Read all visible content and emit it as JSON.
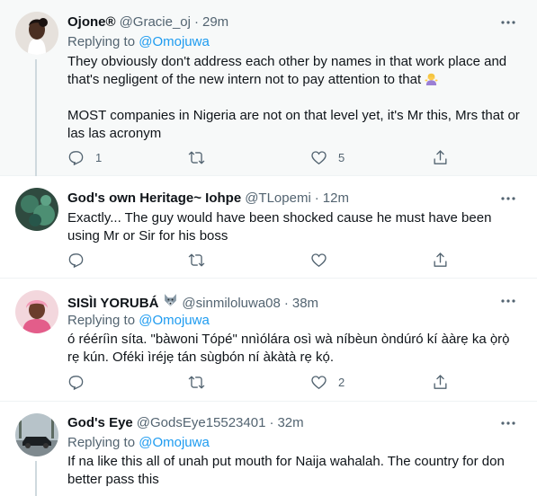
{
  "tweets": [
    {
      "name": "Ojone®",
      "handle": "@Gracie_oj",
      "time": "29m",
      "replying_prefix": "Replying to",
      "replying_to": "@Omojuwa",
      "paragraphs": [
        "They obviously don't address each other by names in that work place and that's negligent of the new intern not to pay attention to that",
        "MOST companies in Nigeria are not on that level yet, it's Mr this, Mrs that or las las acronym"
      ],
      "reply_count": "1",
      "retweet_count": "",
      "like_count": "5"
    },
    {
      "name": "God's own Heritage~ Iohpe",
      "handle": "@TLopemi",
      "time": "12m",
      "paragraphs": [
        "Exactly... The guy would have been shocked cause he must have been using Mr or Sir for his boss"
      ],
      "reply_count": "",
      "retweet_count": "",
      "like_count": ""
    },
    {
      "name": "SISÌI YORUBÁ",
      "handle": "@sinmiloluwa08",
      "time": "38m",
      "replying_prefix": "Replying to",
      "replying_to": "@Omojuwa",
      "paragraphs": [
        "ó rééríìn síta. \"bàwoni Tópé\" nnìólára osì wà níbèun òndúró kí ààrẹ ka ọ̀rọ̀ rẹ kún. Oféki ìréjẹ tán sùgbón ní àkàtà rẹ kọ́."
      ],
      "reply_count": "",
      "retweet_count": "",
      "like_count": "2"
    },
    {
      "name": "God's Eye",
      "handle": "@GodsEye15523401",
      "time": "32m",
      "replying_prefix": "Replying to",
      "replying_to": "@Omojuwa",
      "paragraphs": [
        "If na like this all of unah put mouth for Naija wahalah. The country for don better pass this"
      ]
    }
  ],
  "separator": "·",
  "icons": [
    "more-icon",
    "reply-icon",
    "retweet-icon",
    "like-icon",
    "share-icon",
    "wolf-emoji-icon",
    "shrug-emoji-icon"
  ],
  "colors": {
    "text": "#0f1419",
    "secondary": "#536471",
    "link": "#1d9bf0",
    "highlight_bg": "#f7f9f9",
    "border": "#eff3f4"
  }
}
